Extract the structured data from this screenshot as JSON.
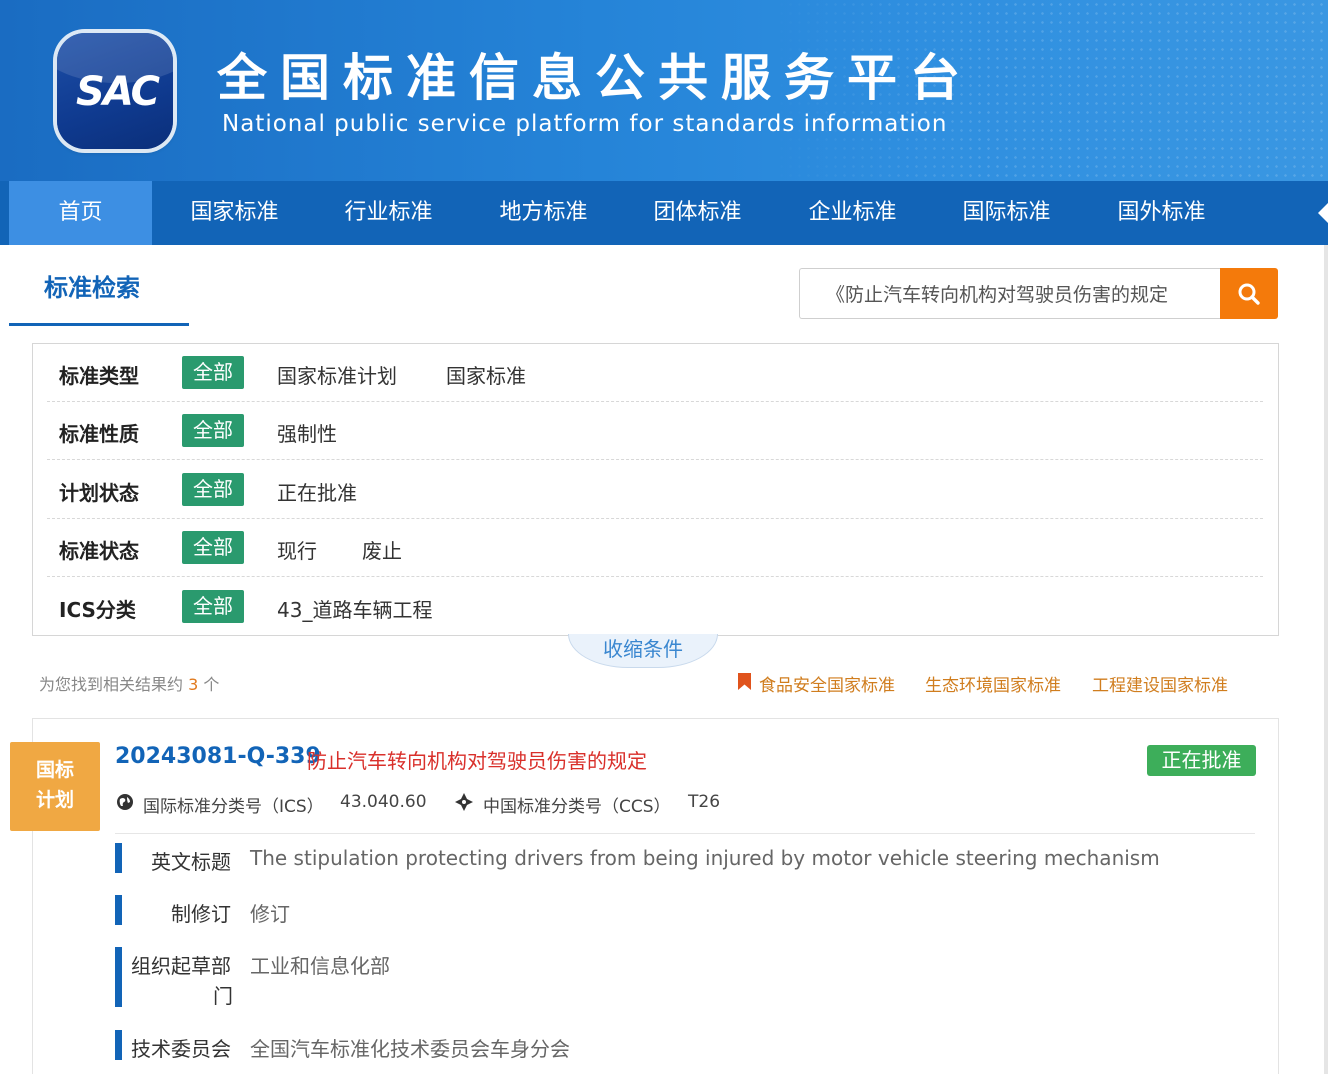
{
  "header": {
    "logo_text": "SAC",
    "title": "全国标准信息公共服务平台",
    "subtitle": "National public service platform  for standards information"
  },
  "nav": {
    "items": [
      "首页",
      "国家标准",
      "行业标准",
      "地方标准",
      "团体标准",
      "企业标准",
      "国际标准",
      "国外标准"
    ],
    "active": "首页"
  },
  "search": {
    "tab_label": "标准检索",
    "query": "《防止汽车转向机构对驾驶员伤害的规定",
    "button_icon": "search-icon"
  },
  "filters": [
    {
      "label": "标准类型",
      "all": "全部",
      "options": [
        "国家标准计划",
        "国家标准"
      ]
    },
    {
      "label": "标准性质",
      "all": "全部",
      "options": [
        "强制性"
      ]
    },
    {
      "label": "计划状态",
      "all": "全部",
      "options": [
        "正在批准"
      ]
    },
    {
      "label": "标准状态",
      "all": "全部",
      "options": [
        "现行",
        "废止"
      ]
    },
    {
      "label": "ICS分类",
      "all": "全部",
      "options": [
        "43_道路车辆工程"
      ]
    }
  ],
  "collapse_label": "收缩条件",
  "results": {
    "count_prefix": "为您找到相关结果约",
    "count": "3",
    "count_suffix": "个"
  },
  "special_links": [
    "食品安全国家标准",
    "生态环境国家标准",
    "工程建设国家标准"
  ],
  "result": {
    "ribbon_line1": "国标",
    "ribbon_line2": "计划",
    "code": "20243081-Q-339",
    "title": "防止汽车转向机构对驾驶员伤害的规定",
    "status": "正在批准",
    "ics_label": "国际标准分类号（ICS）",
    "ics_value": "43.040.60",
    "ccs_label": "中国标准分类号（CCS）",
    "ccs_value": "T26",
    "details": {
      "english_title_label": "英文标题",
      "english_title": "The stipulation protecting drivers from being injured by motor vehicle steering mechanism",
      "revision_label": "制修订",
      "revision": "修订",
      "drafting_dept_label_1": "组织起草部",
      "drafting_dept_label_2": "门",
      "drafting_dept": "工业和信息化部",
      "committee_label": "技术委员会",
      "committee": "全国汽车标准化技术委员会车身分会"
    }
  },
  "colors": {
    "nav_bg": "#1264b7",
    "nav_active": "#3d8fe3",
    "chip_green": "#2a9a6e",
    "search_orange": "#f47a0b",
    "status_green": "#3dae5a",
    "ribbon_orange": "#f0a843",
    "title_red": "#d9302b"
  }
}
